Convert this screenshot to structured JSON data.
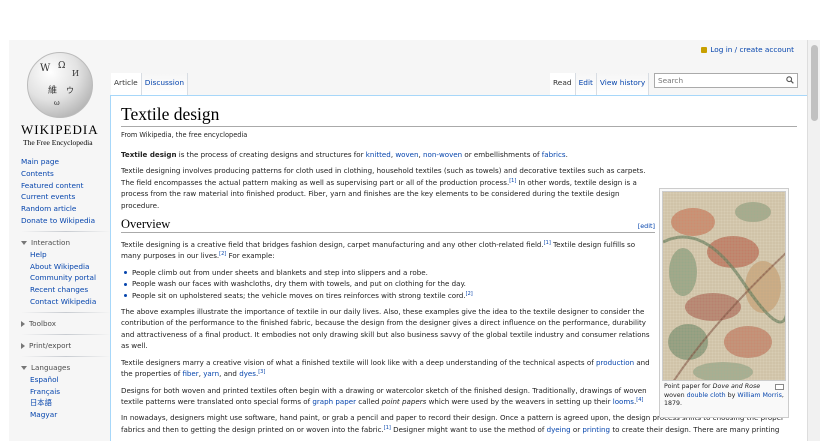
{
  "personal": {
    "login_label": "Log in / create account"
  },
  "logo": {
    "wordmark": "Wikipedia",
    "tagline": "The Free Encyclopedia"
  },
  "nav": {
    "main": [
      "Main page",
      "Contents",
      "Featured content",
      "Current events",
      "Random article",
      "Donate to Wikipedia"
    ],
    "interaction": {
      "heading": "Interaction",
      "items": [
        "Help",
        "About Wikipedia",
        "Community portal",
        "Recent changes",
        "Contact Wikipedia"
      ]
    },
    "toolbox": {
      "heading": "Toolbox"
    },
    "print": {
      "heading": "Print/export"
    },
    "languages": {
      "heading": "Languages",
      "items": [
        "Español",
        "Français",
        "日本語",
        "Magyar"
      ]
    }
  },
  "tabs": {
    "article": "Article",
    "discussion": "Discussion",
    "read": "Read",
    "edit": "Edit",
    "history": "View history"
  },
  "search": {
    "placeholder": "Search"
  },
  "article": {
    "title": "Textile design",
    "subtitle": "From Wikipedia, the free encyclopedia",
    "section_overview": "Overview",
    "edit_label": "[edit]"
  },
  "figure": {
    "caption_pre": "Point paper for",
    "caption_title": "Dove and Rose",
    "caption_mid": "woven",
    "caption_link1": "double cloth",
    "caption_by": "by",
    "caption_link2": "William Morris",
    "caption_year": ", 1879."
  },
  "colors": {
    "link": "#0645ad",
    "content_border": "#a7d7f9",
    "background": "#f6f6f6"
  }
}
